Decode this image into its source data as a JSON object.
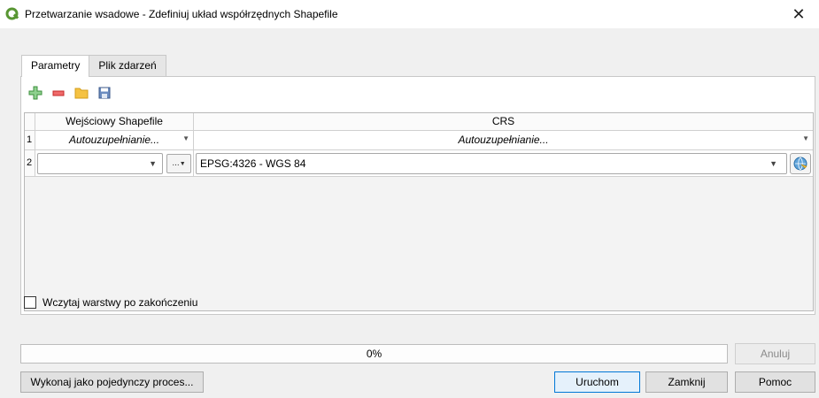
{
  "window": {
    "title": "Przetwarzanie wsadowe - Zdefiniuj układ współrzędnych Shapefile",
    "close_glyph": "✕"
  },
  "tabs": [
    {
      "label": "Parametry",
      "active": true
    },
    {
      "label": "Plik zdarzeń",
      "active": false
    }
  ],
  "toolbar": {
    "icons": [
      "add-row-icon",
      "remove-row-icon",
      "open-folder-icon",
      "save-icon"
    ]
  },
  "table": {
    "headers": [
      "Wejściowy Shapefile",
      "CRS"
    ],
    "rows": [
      {
        "num": "1",
        "input": "Autouzupełnianie...",
        "crs": "Autouzupełnianie..."
      },
      {
        "num": "2",
        "input": "",
        "crs": "EPSG:4326 - WGS 84"
      }
    ],
    "browse_label": "..."
  },
  "load_layers_label": "Wczytaj warstwy po zakończeniu",
  "progress": {
    "text": "0%",
    "value": 0
  },
  "buttons": {
    "cancel": "Anuluj",
    "run_single": "Wykonaj jako pojedynczy proces...",
    "run": "Uruchom",
    "close": "Zamknij",
    "help": "Pomoc"
  },
  "colors": {
    "accent": "#0078d7",
    "qgis_green": "#589632",
    "add_green": "#4caf50",
    "remove_red": "#e53935",
    "folder_yellow": "#f5c242",
    "save_blue": "#4a6fa5"
  }
}
